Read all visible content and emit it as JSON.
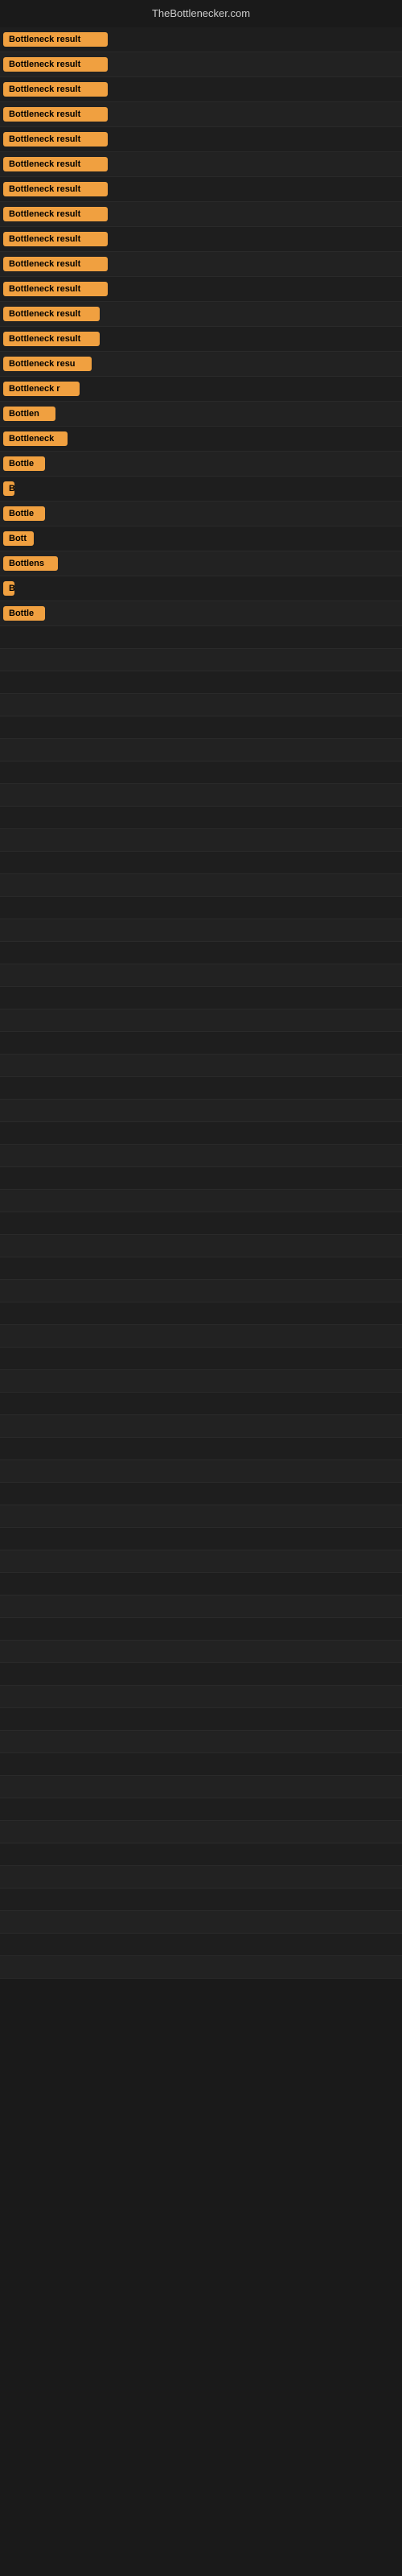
{
  "header": {
    "title": "TheBottlenecker.com"
  },
  "badges": [
    {
      "label": "Bottleneck result",
      "width": "full"
    },
    {
      "label": "Bottleneck result",
      "width": "full"
    },
    {
      "label": "Bottleneck result",
      "width": "full"
    },
    {
      "label": "Bottleneck result",
      "width": "full"
    },
    {
      "label": "Bottleneck result",
      "width": "full"
    },
    {
      "label": "Bottleneck result",
      "width": "full"
    },
    {
      "label": "Bottleneck result",
      "width": "full"
    },
    {
      "label": "Bottleneck result",
      "width": "full"
    },
    {
      "label": "Bottleneck result",
      "width": "full"
    },
    {
      "label": "Bottleneck result",
      "width": "full"
    },
    {
      "label": "Bottleneck result",
      "width": "full"
    },
    {
      "label": "Bottleneck result",
      "width": "partial1"
    },
    {
      "label": "Bottleneck result",
      "width": "partial1"
    },
    {
      "label": "Bottleneck resu",
      "width": "partial2"
    },
    {
      "label": "Bottleneck r",
      "width": "partial3"
    },
    {
      "label": "Bottlen",
      "width": "partial4"
    },
    {
      "label": "Bottleneck",
      "width": "partial5"
    },
    {
      "label": "Bottle",
      "width": "partial6"
    },
    {
      "label": "B",
      "width": "tiny"
    },
    {
      "label": "Bottle",
      "width": "partial6"
    },
    {
      "label": "Bott",
      "width": "micro"
    },
    {
      "label": "Bottlens",
      "width": "partial7"
    },
    {
      "label": "B",
      "width": "tiny2"
    },
    {
      "label": "Bottle",
      "width": "partial6"
    }
  ]
}
